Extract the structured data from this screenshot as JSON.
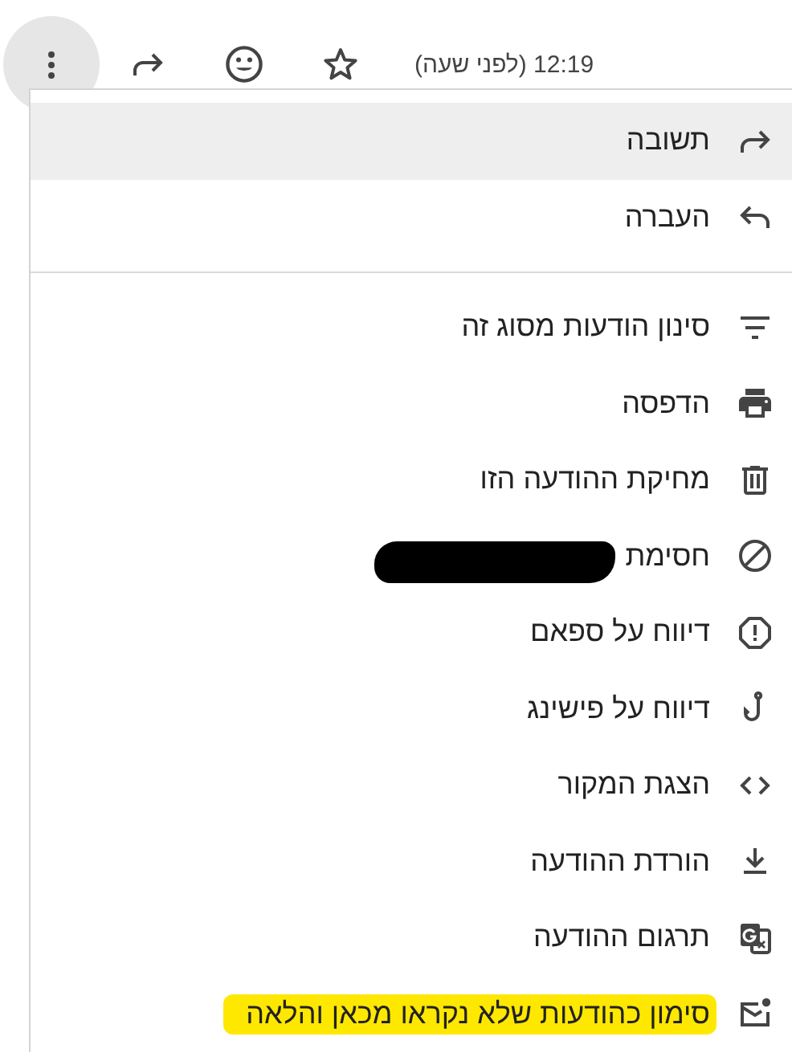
{
  "toolbar": {
    "time": "12:19 (לפני שעה)"
  },
  "menu": {
    "groups": [
      [
        {
          "label": "תשובה",
          "selected": true
        },
        {
          "label": "העברה",
          "selected": false
        }
      ],
      [
        {
          "label": "סינון הודעות מסוג זה",
          "selected": false
        },
        {
          "label": "הדפסה",
          "selected": false
        },
        {
          "label": "מחיקת ההודעה הזו",
          "selected": false
        },
        {
          "label": "חסימת",
          "selected": false,
          "redacted": true
        },
        {
          "label": "דיווח על ספאם",
          "selected": false
        },
        {
          "label": "דיווח על פישינג",
          "selected": false
        },
        {
          "label": "הצגת המקור",
          "selected": false
        },
        {
          "label": "הורדת ההודעה",
          "selected": false
        },
        {
          "label": "תרגום ההודעה",
          "selected": false
        },
        {
          "label": "סימון כהודעות שלא נקראו מכאן והלאה",
          "selected": false,
          "highlighted": true
        }
      ]
    ]
  }
}
